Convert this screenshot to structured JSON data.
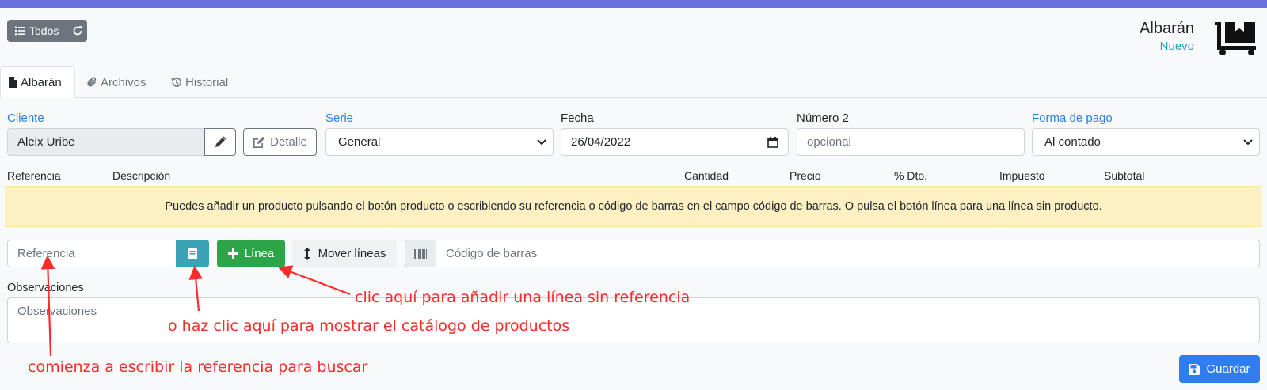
{
  "toolbar": {
    "todos_label": "Todos"
  },
  "header": {
    "title": "Albarán",
    "subtitle": "Nuevo"
  },
  "tabs": [
    {
      "label": "Albarán",
      "icon": "file-icon"
    },
    {
      "label": "Archivos",
      "icon": "paperclip-icon"
    },
    {
      "label": "Historial",
      "icon": "history-icon"
    }
  ],
  "form": {
    "cliente_label": "Cliente",
    "cliente_value": "Aleix Uribe",
    "detalle_label": "Detalle",
    "serie_label": "Serie",
    "serie_value": "General",
    "fecha_label": "Fecha",
    "fecha_value": "26/04/2022",
    "numero2_label": "Número 2",
    "numero2_placeholder": "opcional",
    "forma_pago_label": "Forma de pago",
    "forma_pago_value": "Al contado"
  },
  "lines_table": {
    "columns": [
      "Referencia",
      "Descripción",
      "Cantidad",
      "Precio",
      "% Dto.",
      "Impuesto",
      "Subtotal"
    ]
  },
  "alert": {
    "text": "Puedes añadir un producto pulsando el botón producto o escribiendo su referencia o código de barras en el campo código de barras. O pulsa el botón línea para una línea sin producto."
  },
  "line_tools": {
    "referencia_placeholder": "Referencia",
    "linea_label": "Línea",
    "mover_label": "Mover líneas",
    "barcode_placeholder": "Código de barras"
  },
  "observaciones": {
    "label": "Observaciones",
    "placeholder": "Observaciones"
  },
  "guardar_label": "Guardar",
  "annotations": {
    "linea": "clic aquí para añadir una línea sin referencia",
    "catalogo": "o haz clic aquí para mostrar el catálogo de productos",
    "referencia": "comienza a escribir la referencia para buscar"
  },
  "colors": {
    "topbar": "#6c6fdf",
    "link_blue": "#2f7ee8",
    "success": "#2ea448",
    "info": "#3aa3b6",
    "primary": "#2f7ef1",
    "alert_bg": "#fdf1c4",
    "annotation_red": "#ff2a2a"
  }
}
